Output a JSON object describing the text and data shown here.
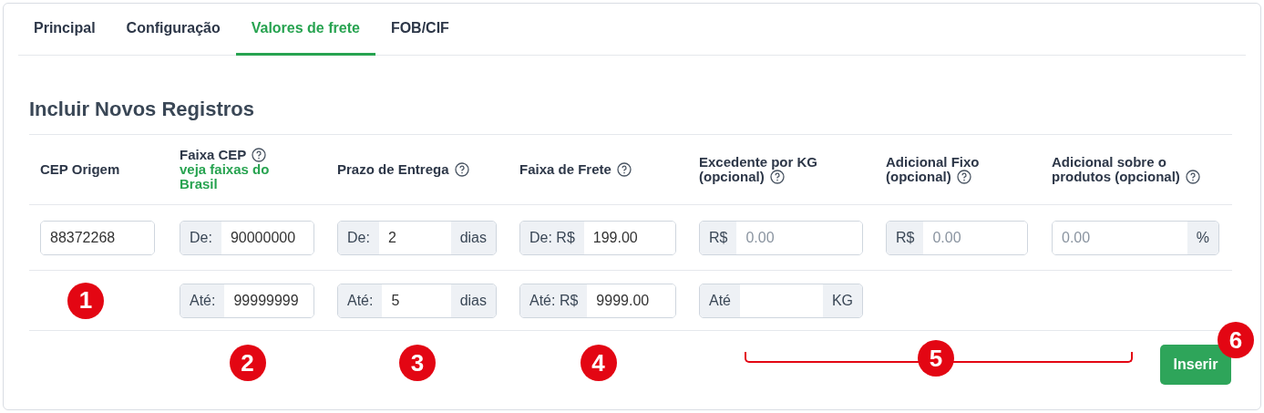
{
  "tabs": [
    {
      "label": "Principal",
      "selected": false
    },
    {
      "label": "Configuração",
      "selected": false
    },
    {
      "label": "Valores de frete",
      "selected": true
    },
    {
      "label": "FOB/CIF",
      "selected": false
    }
  ],
  "heading": "Incluir Novos Registros",
  "columns": [
    {
      "label": "CEP Origem",
      "help": false
    },
    {
      "label": "Faixa CEP",
      "help": true,
      "link": "veja faixas do Brasil"
    },
    {
      "label": "Prazo de Entrega",
      "help": true
    },
    {
      "label": "Faixa de Frete",
      "help": true
    },
    {
      "label": "Excedente por KG (opcional)",
      "help": true
    },
    {
      "label": "Adicional Fixo (opcional)",
      "help": true
    },
    {
      "label": "Adicional sobre o produtos (opcional)",
      "help": true
    }
  ],
  "rows": [
    [
      {
        "value": "88372268"
      },
      {
        "prefix": "De:",
        "value": "90000000"
      },
      {
        "prefix": "De:",
        "value": "2",
        "suffix": "dias"
      },
      {
        "prefix": "De: R$",
        "value": "199.00"
      },
      {
        "prefix": "R$",
        "placeholder": "0.00"
      },
      {
        "prefix": "R$",
        "placeholder": "0.00"
      },
      {
        "placeholder": "0.00",
        "suffix": "%"
      }
    ],
    [
      null,
      {
        "prefix": "Até:",
        "value": "99999999"
      },
      {
        "prefix": "Até:",
        "value": "5",
        "suffix": "dias"
      },
      {
        "prefix": "Até: R$",
        "value": "9999.00"
      },
      {
        "prefix": "Até",
        "suffix": "KG"
      },
      null,
      null
    ]
  ],
  "markers": [
    "1",
    "2",
    "3",
    "4",
    "5",
    "6"
  ],
  "insert_button": "Inserir"
}
